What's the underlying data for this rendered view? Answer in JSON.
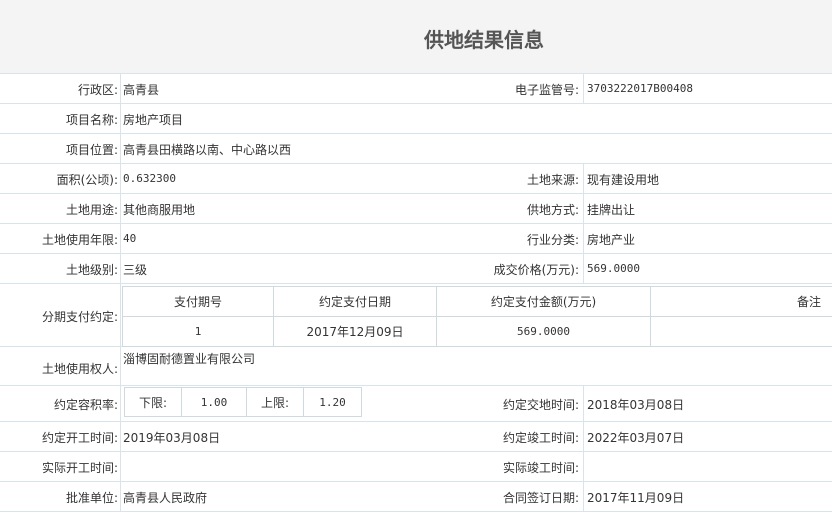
{
  "page_title": "供地结果信息",
  "labels": {
    "region": "行政区:",
    "supervise_no": "电子监管号:",
    "project_name": "项目名称:",
    "project_location": "项目位置:",
    "area": "面积(公顷):",
    "land_source": "土地来源:",
    "land_use": "土地用途:",
    "supply_method": "供地方式:",
    "use_years": "土地使用年限:",
    "industry": "行业分类:",
    "land_level": "土地级别:",
    "deal_price": "成交价格(万元):",
    "installment": "分期支付约定:",
    "land_user": "土地使用权人:",
    "far": "约定容积率:",
    "delivery_time": "约定交地时间:",
    "start_time": "约定开工时间:",
    "finish_time": "约定竣工时间:",
    "actual_start": "实际开工时间:",
    "actual_finish": "实际竣工时间:",
    "approve_unit": "批准单位:",
    "contract_date": "合同签订日期:"
  },
  "values": {
    "region": "高青县",
    "supervise_no": "3703222017B00408",
    "project_name": "房地产项目",
    "project_location": "高青县田横路以南、中心路以西",
    "area": "0.632300",
    "land_source": "现有建设用地",
    "land_use": "其他商服用地",
    "supply_method": "挂牌出让",
    "use_years": "40",
    "industry": "房地产业",
    "land_level": "三级",
    "deal_price": "569.0000",
    "land_user": "淄博固耐德置业有限公司",
    "delivery_time": "2018年03月08日",
    "start_time": "2019年03月08日",
    "finish_time": "2022年03月07日",
    "actual_start": "",
    "actual_finish": "",
    "approve_unit": "高青县人民政府",
    "contract_date": "2017年11月09日"
  },
  "installment_table": {
    "headers": [
      "支付期号",
      "约定支付日期",
      "约定支付金额(万元)",
      "备注"
    ],
    "rows": [
      [
        "1",
        "2017年12月09日",
        "569.0000",
        ""
      ]
    ]
  },
  "far": {
    "lower_label": "下限:",
    "lower_value": "1.00",
    "upper_label": "上限:",
    "upper_value": "1.20"
  }
}
